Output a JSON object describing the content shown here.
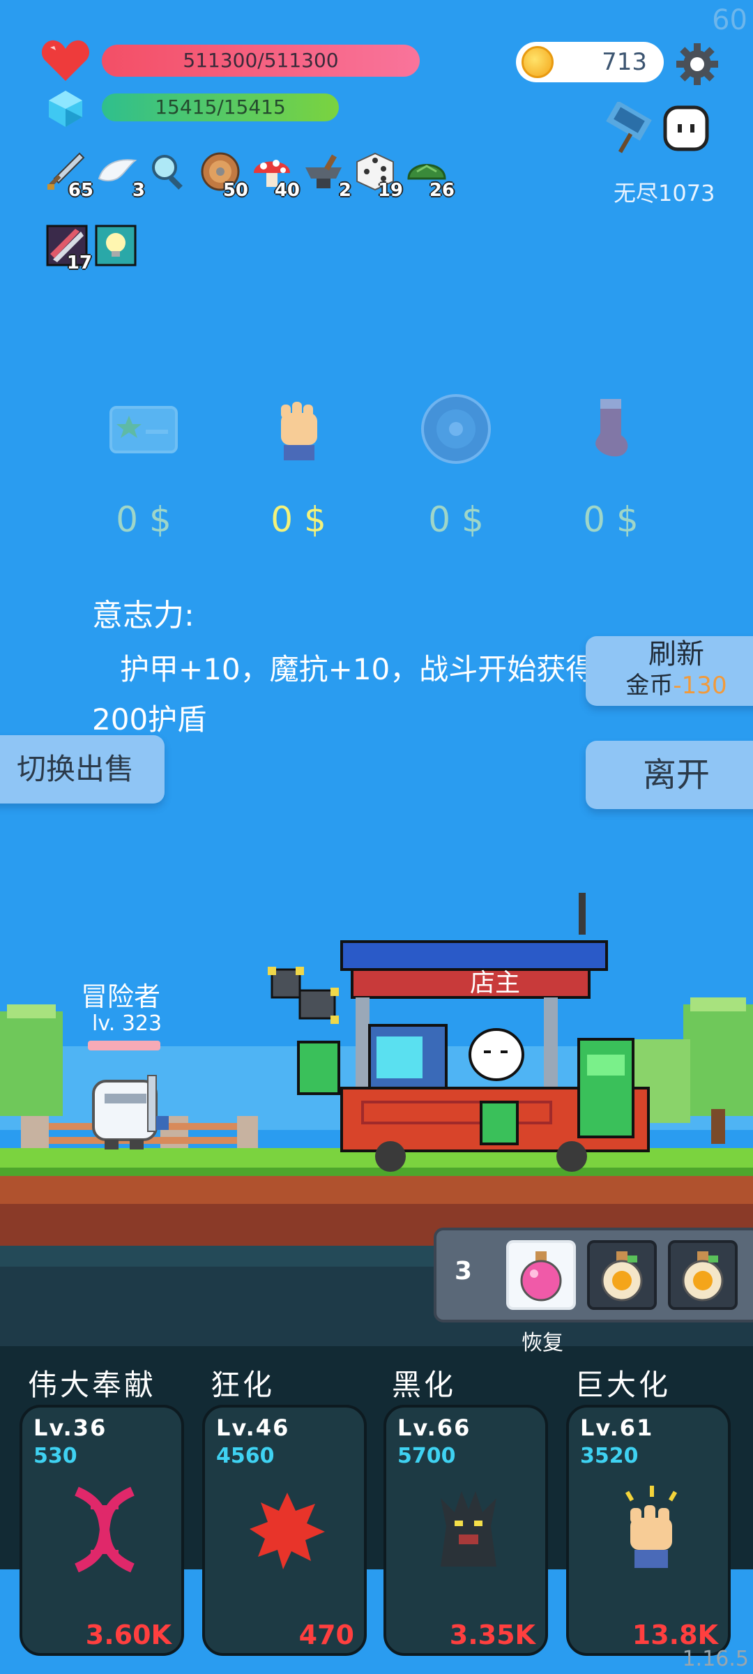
{
  "fps": "60",
  "hp": {
    "text": "511300/511300",
    "fraction": 1.0
  },
  "mp": {
    "text": "15415/15415",
    "fraction": 1.0
  },
  "coins": "713",
  "mode_label": "无尽1073",
  "items": [
    {
      "icon": "sword-icon",
      "count": "65"
    },
    {
      "icon": "wing-icon",
      "count": "3"
    },
    {
      "icon": "magnifier-icon",
      "count": ""
    },
    {
      "icon": "shield-round-icon",
      "count": "50"
    },
    {
      "icon": "mushroom-icon",
      "count": "40"
    },
    {
      "icon": "anvil-icon",
      "count": "2"
    },
    {
      "icon": "dice-icon",
      "count": "19"
    },
    {
      "icon": "turtle-shell-icon",
      "count": "26"
    }
  ],
  "relics": [
    {
      "icon": "scroll-icon",
      "count": "17"
    },
    {
      "icon": "lightbulb-icon",
      "count": ""
    }
  ],
  "shop": {
    "items": [
      {
        "icon": "star-card-icon",
        "price": "0 $"
      },
      {
        "icon": "fist-icon",
        "price": "0 $"
      },
      {
        "icon": "round-shield-icon",
        "price": "0 $"
      },
      {
        "icon": "sock-icon",
        "price": "0 $"
      }
    ],
    "selected_index": 1,
    "desc_title": "意志力:",
    "desc_body": "护甲+10，魔抗+10，战斗开始获得200护盾",
    "refresh_label": "刷新",
    "refresh_cost_prefix": "金币",
    "refresh_cost": "-130",
    "leave_label": "离开",
    "switch_label": "切换出售"
  },
  "scene": {
    "adventurer_name": "冒险者",
    "adventurer_level": "lv. 323",
    "owner_label": "店主"
  },
  "potions": {
    "count": "3",
    "label": "恢复"
  },
  "skills": [
    {
      "name": "伟大奉献",
      "level": "Lv.36",
      "value": "530",
      "cost": "3.60K",
      "icon": "dna-icon"
    },
    {
      "name": "狂化",
      "level": "Lv.46",
      "value": "4560",
      "cost": "470",
      "icon": "blood-splat-icon"
    },
    {
      "name": "黑化",
      "level": "Lv.66",
      "value": "5700",
      "cost": "3.35K",
      "icon": "dark-tree-icon"
    },
    {
      "name": "巨大化",
      "level": "Lv.61",
      "value": "3520",
      "cost": "13.8K",
      "icon": "fist-icon"
    }
  ],
  "version": "1.16.5"
}
